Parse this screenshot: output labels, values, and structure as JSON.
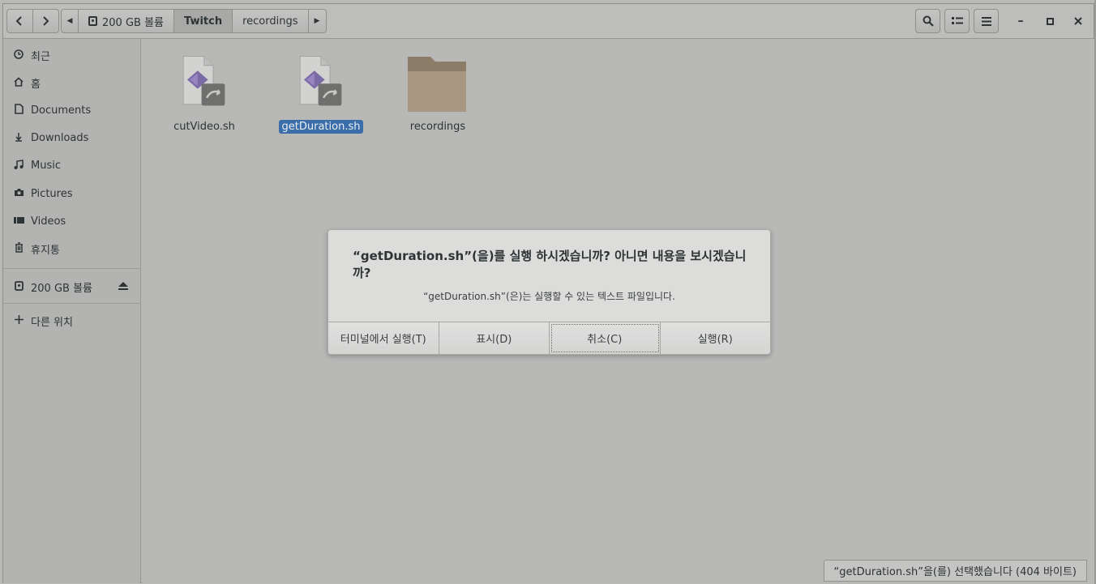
{
  "header": {
    "path": [
      "200 GB 볼륨",
      "Twitch",
      "recordings"
    ],
    "active_index": 1
  },
  "sidebar": {
    "items": [
      {
        "label": "최근",
        "icon": "clock-icon"
      },
      {
        "label": "홈",
        "icon": "home-icon"
      },
      {
        "label": "Documents",
        "icon": "document-icon"
      },
      {
        "label": "Downloads",
        "icon": "download-icon"
      },
      {
        "label": "Music",
        "icon": "music-icon"
      },
      {
        "label": "Pictures",
        "icon": "camera-icon"
      },
      {
        "label": "Videos",
        "icon": "video-icon"
      },
      {
        "label": "휴지통",
        "icon": "trash-icon"
      }
    ],
    "volume": {
      "label": "200 GB 볼륨"
    },
    "other": {
      "label": "다른 위치"
    }
  },
  "files": [
    {
      "name": "cutVideo.sh",
      "type": "script"
    },
    {
      "name": "getDuration.sh",
      "type": "script",
      "selected": true
    },
    {
      "name": "recordings",
      "type": "folder"
    }
  ],
  "dialog": {
    "title": "“getDuration.sh”(을)를 실행 하시겠습니까? 아니면 내용을 보시겠습니까?",
    "subtitle": "“getDuration.sh”(은)는 실행할 수 있는 텍스트 파일입니다.",
    "buttons": [
      "터미널에서 실행(T)",
      "표시(D)",
      "취소(C)",
      "실행(R)"
    ]
  },
  "status": "“getDuration.sh”을(를) 선택했습니다 (404 바이트)",
  "colors": {
    "selection": "#3b6ea8",
    "folder": "#a89882"
  }
}
